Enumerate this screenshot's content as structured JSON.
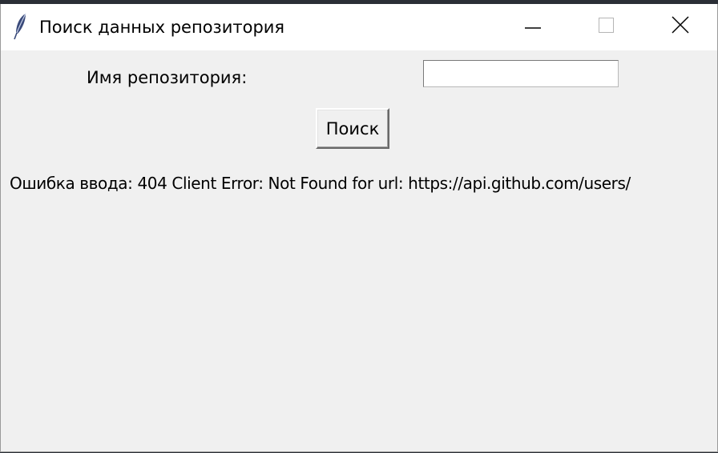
{
  "window": {
    "title": "Поиск данных репозитория",
    "icon": "feather-icon",
    "controls": [
      "minimize-icon",
      "maximize-icon",
      "close-icon"
    ]
  },
  "form": {
    "name_label": "Имя репозитория:",
    "name_value": "",
    "name_placeholder": "",
    "search_button_label": "Поиск"
  },
  "status": {
    "error_message": "Ошибка ввода: 404 Client Error: Not Found for url: https://api.github.com/users/"
  }
}
